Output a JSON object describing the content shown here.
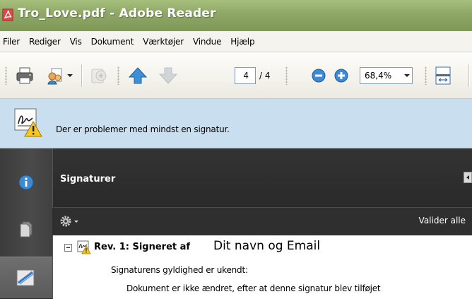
{
  "window": {
    "title": "Tro_Love.pdf - Adobe Reader",
    "app_icon": "pdf-icon"
  },
  "menu": {
    "items": [
      "Filer",
      "Rediger",
      "Vis",
      "Dokument",
      "Værktøjer",
      "Vindue",
      "Hjælp"
    ]
  },
  "toolbar": {
    "current_page": "4",
    "page_total": "/ 4",
    "zoom": "68,4%",
    "icons": [
      "print-icon",
      "collaborate-icon",
      "share-icon",
      "previous-page-icon",
      "next-page-icon",
      "zoom-out-icon",
      "zoom-in-icon",
      "fit-page-icon"
    ]
  },
  "message_bar": {
    "icon": "signature-warning-icon",
    "text": "Der er problemer med mindst en signatur."
  },
  "nav_panel": {
    "buttons": [
      "info-icon",
      "pages-icon",
      "signatures-icon"
    ]
  },
  "signatures_panel": {
    "title": "Signaturer",
    "options_icon": "gear-icon",
    "validate_all": "Valider alle",
    "revision": {
      "label": "Rev. 1: Signeret af",
      "signer": "Dit navn og Email",
      "validity": "Signaturens gyldighed er ukendt:",
      "detail": "Dokument er ikke ændret, efter at denne signatur blev tilføjet"
    }
  },
  "colors": {
    "titlebar": "#8ea766",
    "message_bar": "#c9dff0",
    "panel_dark": "#2f2f2f"
  }
}
